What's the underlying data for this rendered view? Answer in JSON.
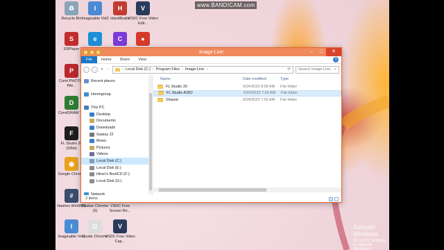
{
  "watermark": "www.BANDICAM.com",
  "desktop_icons": [
    {
      "label": "Recycle Bin",
      "color": "#8aa5b8",
      "glyph": "♻"
    },
    {
      "label": "Imaginable Vid2",
      "color": "#4a8bd4",
      "glyph": "I"
    },
    {
      "label": "HandBrake",
      "color": "#c23b2f",
      "glyph": "H"
    },
    {
      "label": "VSDC Free Video Edit...",
      "color": "#2a3a5a",
      "glyph": "V"
    },
    {
      "label": "SSPlayer",
      "color": "#c22c2c",
      "glyph": "S"
    },
    {
      "label": "Microsoft Edge",
      "color": "#1e8fd6",
      "glyph": "e"
    },
    {
      "label": "Clipchamp",
      "color": "#7c3bd6",
      "glyph": "C"
    },
    {
      "label": "Record",
      "color": "#d63a2a",
      "glyph": "●"
    },
    {
      "label": "Corel PHOTO-PAI...",
      "color": "#b8282a",
      "glyph": "P"
    },
    {
      "label": "CorelDRAW X7",
      "color": "#2e7d32",
      "glyph": "D"
    },
    {
      "label": "FL Studio 20 (32bit)",
      "color": "#1e1e1e",
      "glyph": "F"
    },
    {
      "label": "Google Chrome",
      "color": "#e9a21f",
      "glyph": "◉"
    },
    {
      "label": "Hashes WinMD5",
      "color": "#3b4d6c",
      "glyph": "#"
    },
    {
      "label": "Kasbar Chrome (5)",
      "color": "#dddddd",
      "glyph": "K"
    },
    {
      "label": "VSDC Free Screen Re...",
      "color": "#2a3a5a",
      "glyph": "V"
    },
    {
      "label": "Imaginable Vid1",
      "color": "#4a8bd4",
      "glyph": "I"
    },
    {
      "label": "Guide Chrome",
      "color": "#dddddd",
      "glyph": "G"
    },
    {
      "label": "VSDC Free Video Cap...",
      "color": "#2a3a5a",
      "glyph": "V"
    }
  ],
  "explorer": {
    "title": "Image-Line",
    "ribbon_tabs": [
      "File",
      "Home",
      "Share",
      "View"
    ],
    "address_segments": [
      "Local Disk (C:)",
      "Program Files",
      "Image-Line"
    ],
    "search_placeholder": "Search Image-Line",
    "nav_items": [
      {
        "label": "Recent places",
        "color": "#6b8fc5",
        "selected": false
      },
      {
        "label": "",
        "color": "transparent",
        "selected": false
      },
      {
        "label": "Homegroup",
        "color": "#3f8fcf",
        "selected": false
      },
      {
        "label": "",
        "color": "transparent",
        "selected": false
      },
      {
        "label": "This PC",
        "color": "#4c7bb8",
        "selected": false
      },
      {
        "label": "Desktop",
        "color": "#3a7fc9",
        "selected": false
      },
      {
        "label": "Documents",
        "color": "#c9a95b",
        "selected": false
      },
      {
        "label": "Downloads",
        "color": "#3a7fc9",
        "selected": false
      },
      {
        "label": "Galaxy J2",
        "color": "#777777",
        "selected": false
      },
      {
        "label": "Music",
        "color": "#3a7fc9",
        "selected": false
      },
      {
        "label": "Pictures",
        "color": "#c9a95b",
        "selected": false
      },
      {
        "label": "Videos",
        "color": "#6f6f9f",
        "selected": false
      },
      {
        "label": "Local Disk (C:)",
        "color": "#7d9bb7",
        "selected": true
      },
      {
        "label": "Local Disk (E:)",
        "color": "#8c8c8c",
        "selected": false
      },
      {
        "label": "Hiren's BootCD (F:)",
        "color": "#8c8c8c",
        "selected": false
      },
      {
        "label": "Local Disk (G:)",
        "color": "#8c8c8c",
        "selected": false
      },
      {
        "label": "",
        "color": "transparent",
        "selected": false
      },
      {
        "label": "Network",
        "color": "#3f8fcf",
        "selected": false
      }
    ],
    "columns": {
      "name": "Name",
      "date": "Date modified",
      "type": "Type"
    },
    "files": [
      {
        "name": "FL Studio 20",
        "date": "6/24/2023 8:58 AM",
        "type": "File folder",
        "highlighted": false
      },
      {
        "name": "FL Studio ASIO",
        "date": "6/24/2023 7:59 AM",
        "type": "File folder",
        "highlighted": true
      },
      {
        "name": "Shared",
        "date": "6/24/2023 7:59 AM",
        "type": "File folder",
        "highlighted": false
      }
    ],
    "status": "3 items"
  },
  "activate": {
    "line1": "Activate Windows",
    "line2": "Go to PC settings to activate Windows."
  }
}
